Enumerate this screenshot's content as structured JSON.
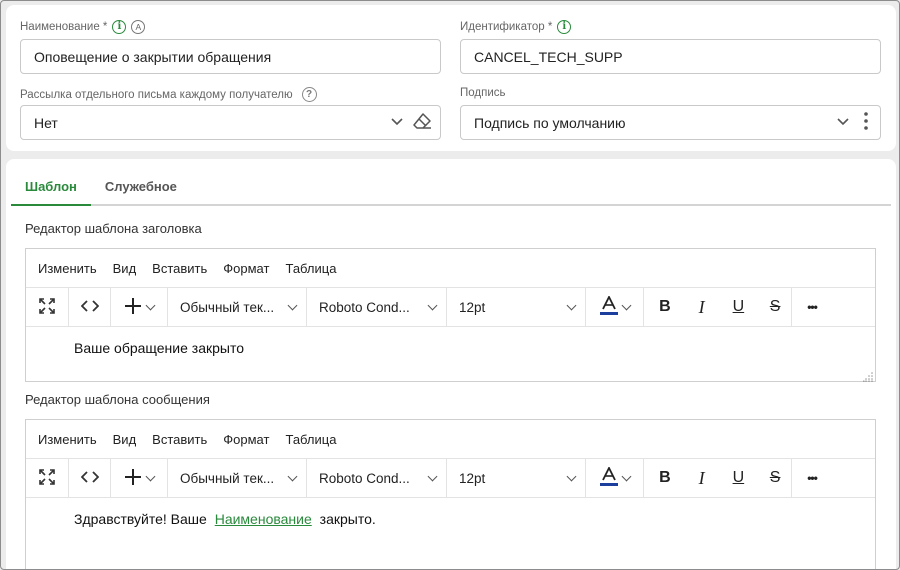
{
  "fields": {
    "name": {
      "label": "Наименование *",
      "value": "Оповещение о закрытии обращения"
    },
    "identifier": {
      "label": "Идентификатор *",
      "value": "CANCEL_TECH_SUPP"
    },
    "mailing": {
      "label": "Рассылка отдельного письма каждому получателю",
      "value": "Нет"
    },
    "signature": {
      "label": "Подпись",
      "value": "Подпись по умолчанию"
    }
  },
  "tabs": [
    {
      "label": "Шаблон",
      "active": true
    },
    {
      "label": "Служебное",
      "active": false
    }
  ],
  "editors": [
    {
      "title": "Редактор шаблона заголовка",
      "content": "Ваше обращение закрыто"
    },
    {
      "title": "Редактор шаблона сообщения",
      "content_before": "Здравствуйте! Ваше",
      "content_link": "Наименование",
      "content_after": "закрыто."
    }
  ],
  "menu": [
    "Изменить",
    "Вид",
    "Вставить",
    "Формат",
    "Таблица"
  ],
  "toolbar": {
    "block_format": "Обычный тек...",
    "font_family": "Roboto Cond...",
    "font_size": "12pt",
    "bold": "B",
    "italic": "I",
    "underline": "U",
    "strike": "S",
    "more": "•••"
  },
  "colors": {
    "accent": "#2a8a3c",
    "text_color_bar": "#1c3f9e"
  },
  "icons": [
    "info-icon",
    "autofill-icon",
    "help-icon",
    "chevron-down-icon",
    "eraser-icon",
    "kebab-menu-icon",
    "fullscreen-icon",
    "source-code-icon",
    "plus-icon",
    "text-color-icon",
    "bold-icon",
    "italic-icon",
    "underline-icon",
    "strikethrough-icon",
    "more-icon",
    "resize-handle-icon"
  ]
}
